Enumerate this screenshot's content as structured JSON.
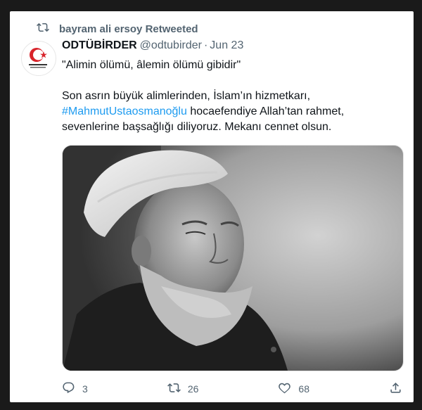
{
  "retweet": {
    "icon": "retweet-icon",
    "label": "bayram ali ersoy Retweeted"
  },
  "tweet": {
    "avatar_icon": "odtubirder-logo",
    "display_name": "ODTÜBİRDER",
    "handle": "@odtubirder",
    "separator": "·",
    "date": "Jun 23",
    "line1": "\"Alimin ölümü, âlemin ölümü gibidir\"",
    "line2": "Son asrın büyük alimlerinden, İslam’ın hizmetkarı,",
    "hashtag": "#MahmutUstaosmanoğlu",
    "line3_rest": " hocaefendiye Allah’tan rahmet,",
    "line4": "sevenlerine başsağlığı diliyoruz. Mekanı cennet olsun."
  },
  "actions": {
    "reply_icon": "reply-icon",
    "reply_count": "3",
    "retweet_icon": "retweet-icon",
    "retweet_count": "26",
    "like_icon": "heart-icon",
    "like_count": "68",
    "share_icon": "share-icon"
  },
  "colors": {
    "link": "#1d9bf0",
    "muted": "#536471",
    "logo_red": "#d8232a"
  }
}
